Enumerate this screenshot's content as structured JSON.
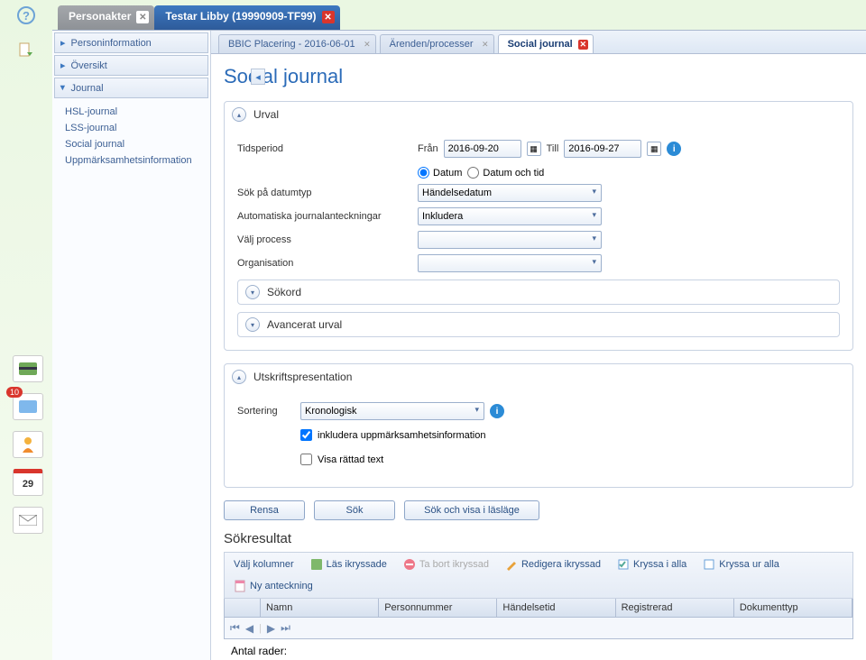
{
  "top_tabs": {
    "inactive": "Personakter",
    "active": "Testar Libby (19990909-TF99)"
  },
  "side_nav": {
    "items": [
      "Personinformation",
      "Översikt",
      "Journal"
    ],
    "journal_sub": [
      "HSL-journal",
      "LSS-journal",
      "Social journal",
      "Uppmärksamhetsinformation"
    ]
  },
  "content_tabs": {
    "t0": "BBIC Placering - 2016-06-01",
    "t1": "Ärenden/processer",
    "t2": "Social journal"
  },
  "page_title": "Social journal",
  "urval": {
    "title": "Urval",
    "tidsperiod_label": "Tidsperiod",
    "fran_label": "Från",
    "fran_value": "2016-09-20",
    "till_label": "Till",
    "till_value": "2016-09-27",
    "radio_datum": "Datum",
    "radio_datum_tid": "Datum och tid",
    "sok_datumtyp_label": "Sök på datumtyp",
    "sok_datumtyp_value": "Händelsedatum",
    "auto_label": "Automatiska journalanteckningar",
    "auto_value": "Inkludera",
    "process_label": "Välj process",
    "process_value": "",
    "org_label": "Organisation",
    "org_value": "",
    "sokord_title": "Sökord",
    "avancerat_title": "Avancerat urval"
  },
  "utskrift": {
    "title": "Utskriftspresentation",
    "sortering_label": "Sortering",
    "sortering_value": "Kronologisk",
    "chk_uppm": "inkludera uppmärksamhetsinformation",
    "chk_rattad": "Visa rättad text"
  },
  "buttons": {
    "rensa": "Rensa",
    "sok": "Sök",
    "sok_las": "Sök och visa i läsläge"
  },
  "results": {
    "title": "Sökresultat",
    "toolbar": {
      "valj_kolumner": "Välj kolumner",
      "las_ikryssade": "Läs ikryssade",
      "ta_bort": "Ta bort ikryssad",
      "redigera": "Redigera ikryssad",
      "kryssa_alla": "Kryssa i alla",
      "kryssa_ur": "Kryssa ur alla",
      "ny_anteckning": "Ny anteckning"
    },
    "columns": [
      "Namn",
      "Personnummer",
      "Händelsetid",
      "Registrerad",
      "Dokumenttyp"
    ],
    "row_count_label": "Antal rader:"
  },
  "rail_badge": "10",
  "rail_calendar_day": "29"
}
